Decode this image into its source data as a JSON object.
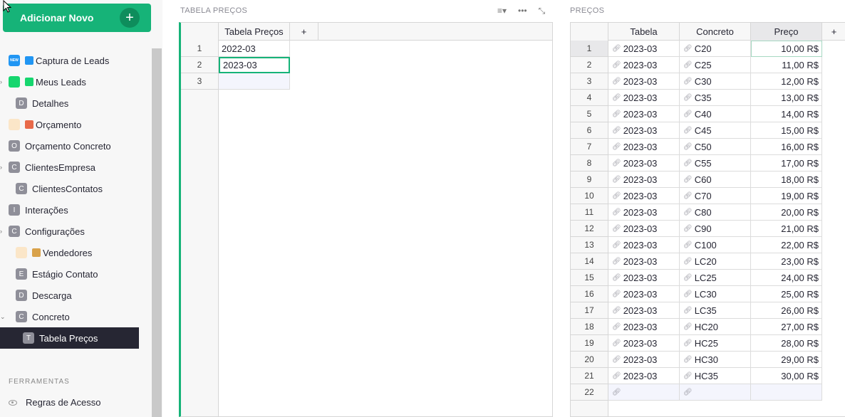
{
  "sidebar": {
    "add_label": "Adicionar Novo",
    "items": [
      {
        "label": "Captura de Leads",
        "badge": "NEW",
        "kind": "blue",
        "chevron": "",
        "indent": 12,
        "mini": "#2196f3"
      },
      {
        "label": "Meus Leads",
        "badge": "",
        "kind": "green",
        "chevron": "›",
        "indent": 12,
        "mini": "#16d66e"
      },
      {
        "label": "Detalhes",
        "badge": "D",
        "kind": "",
        "chevron": "",
        "indent": 22,
        "mini": ""
      },
      {
        "label": "Orçamento",
        "badge": "",
        "kind": "orange",
        "chevron": "",
        "indent": 12,
        "mini": "#e86a4a"
      },
      {
        "label": "Orçamento Concreto",
        "badge": "O",
        "kind": "",
        "chevron": "",
        "indent": 12,
        "mini": ""
      },
      {
        "label": "ClientesEmpresa",
        "badge": "C",
        "kind": "",
        "chevron": "›",
        "indent": 12,
        "mini": ""
      },
      {
        "label": "ClientesContatos",
        "badge": "C",
        "kind": "",
        "chevron": "",
        "indent": 22,
        "mini": ""
      },
      {
        "label": "Interações",
        "badge": "I",
        "kind": "",
        "chevron": "",
        "indent": 12,
        "mini": ""
      },
      {
        "label": "Configurações",
        "badge": "C",
        "kind": "",
        "chevron": "›",
        "indent": 12,
        "mini": ""
      },
      {
        "label": "Vendedores",
        "badge": "",
        "kind": "orange",
        "chevron": "",
        "indent": 22,
        "mini": "#d9a24a"
      },
      {
        "label": "Estágio Contato",
        "badge": "E",
        "kind": "",
        "chevron": "",
        "indent": 22,
        "mini": ""
      },
      {
        "label": "Descarga",
        "badge": "D",
        "kind": "",
        "chevron": "",
        "indent": 22,
        "mini": ""
      },
      {
        "label": "Concreto",
        "badge": "C",
        "kind": "",
        "chevron": "⌄",
        "indent": 22,
        "mini": ""
      },
      {
        "label": "Tabela Preços",
        "badge": "T",
        "kind": "active",
        "chevron": "",
        "indent": 32,
        "mini": ""
      }
    ],
    "tools_section": "FERRAMENTAS",
    "tools_item": "Regras de Acesso"
  },
  "left": {
    "title": "TABELA PREÇOS",
    "column": "Tabela Preços",
    "add_col": "+",
    "rows": [
      "2022-03",
      "2023-03",
      ""
    ]
  },
  "right": {
    "title": "PREÇOS",
    "columns": [
      "Tabela",
      "Concreto",
      "Preço",
      "+"
    ],
    "rows": [
      [
        "2023-03",
        "C20",
        "10,00 R$"
      ],
      [
        "2023-03",
        "C25",
        "11,00 R$"
      ],
      [
        "2023-03",
        "C30",
        "12,00 R$"
      ],
      [
        "2023-03",
        "C35",
        "13,00 R$"
      ],
      [
        "2023-03",
        "C40",
        "14,00 R$"
      ],
      [
        "2023-03",
        "C45",
        "15,00 R$"
      ],
      [
        "2023-03",
        "C50",
        "16,00 R$"
      ],
      [
        "2023-03",
        "C55",
        "17,00 R$"
      ],
      [
        "2023-03",
        "C60",
        "18,00 R$"
      ],
      [
        "2023-03",
        "C70",
        "19,00 R$"
      ],
      [
        "2023-03",
        "C80",
        "20,00 R$"
      ],
      [
        "2023-03",
        "C90",
        "21,00 R$"
      ],
      [
        "2023-03",
        "C100",
        "22,00 R$"
      ],
      [
        "2023-03",
        "LC20",
        "23,00 R$"
      ],
      [
        "2023-03",
        "LC25",
        "24,00 R$"
      ],
      [
        "2023-03",
        "LC30",
        "25,00 R$"
      ],
      [
        "2023-03",
        "LC35",
        "26,00 R$"
      ],
      [
        "2023-03",
        "HC20",
        "27,00 R$"
      ],
      [
        "2023-03",
        "HC25",
        "28,00 R$"
      ],
      [
        "2023-03",
        "HC30",
        "29,00 R$"
      ],
      [
        "2023-03",
        "HC35",
        "30,00 R$"
      ]
    ]
  }
}
